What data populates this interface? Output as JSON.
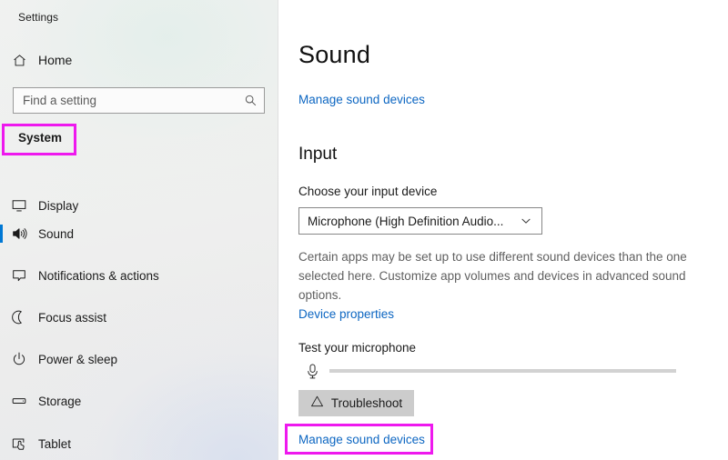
{
  "window": {
    "title": "Settings"
  },
  "sidebar": {
    "home": {
      "label": "Home",
      "icon": "home-icon"
    },
    "search": {
      "placeholder": "Find a setting",
      "value": "",
      "icon": "search-icon"
    },
    "category": "System",
    "items": [
      {
        "label": "Display",
        "icon": "monitor-icon",
        "selected": false
      },
      {
        "label": "Sound",
        "icon": "speaker-icon",
        "selected": true
      },
      {
        "label": "Notifications & actions",
        "icon": "notification-icon",
        "selected": false
      },
      {
        "label": "Focus assist",
        "icon": "moon-icon",
        "selected": false
      },
      {
        "label": "Power & sleep",
        "icon": "power-icon",
        "selected": false
      },
      {
        "label": "Storage",
        "icon": "storage-icon",
        "selected": false
      },
      {
        "label": "Tablet",
        "icon": "tablet-icon",
        "selected": false
      }
    ]
  },
  "main": {
    "page_title": "Sound",
    "manage_sound_devices_top": "Manage sound devices",
    "input_section": {
      "heading": "Input",
      "choose_label": "Choose your input device",
      "device_value": "Microphone (High Definition Audio...",
      "apps_note": "Certain apps may be set up to use different sound devices than the one selected here. Customize app volumes and devices in advanced sound options.",
      "device_properties_link": "Device properties",
      "test_label": "Test your microphone",
      "mic_level_percent": 0,
      "troubleshoot_label": "Troubleshoot",
      "manage_sound_devices_bottom": "Manage sound devices"
    }
  },
  "colors": {
    "accent_blue": "#0078d4",
    "link_blue": "#0c66c2",
    "highlight_magenta": "#ee19ee",
    "button_gray": "#cccccc"
  }
}
